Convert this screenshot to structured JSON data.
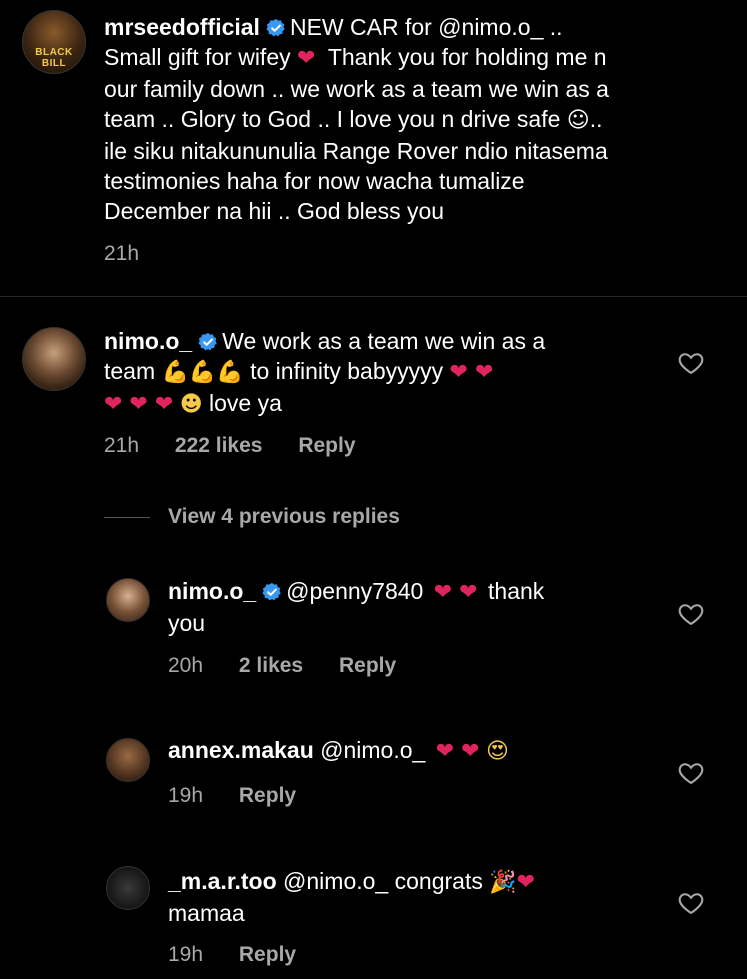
{
  "caption": {
    "username": "mrseedofficial",
    "avatar_text": "BLACK BILL",
    "lines": [
      "NEW CAR for @nimo.o_ ..",
      "Small gift for wifey",
      "Thank you for holding me n",
      "our family down .. we work as a team we win as a",
      "team .. Glory to God .. I love you n drive safe",
      "..",
      "ile siku nitakununulia Range Rover ndio nitasema",
      "testimonies haha for now wacha tumalize",
      "December na hii .. God bless you"
    ],
    "time": "21h"
  },
  "comment": {
    "username": "nimo.o_",
    "line1": "We work as a team we win as a",
    "line2a": "team",
    "line2b": "to infinity babyyyyy",
    "line3": "love ya",
    "time": "21h",
    "likes": "222 likes",
    "reply": "Reply"
  },
  "view_replies": "View 4 previous replies",
  "replies": [
    {
      "username": "nimo.o_",
      "mention": "@penny7840",
      "after": "thank",
      "line2": "you",
      "time": "20h",
      "likes": "2 likes",
      "reply": "Reply"
    },
    {
      "username": "annex.makau",
      "mention": "@nimo.o_",
      "time": "19h",
      "reply": "Reply"
    },
    {
      "username": "_m.a.r.too",
      "mention": "@nimo.o_",
      "text": "congrats",
      "line2": "mamaa",
      "time": "19h",
      "reply": "Reply"
    }
  ],
  "icons": {
    "verified": "verified-badge-icon",
    "like": "heart-outline-icon"
  },
  "colors": {
    "background": "#000000",
    "muted": "#a8a8a8",
    "verified": "#3897f0",
    "heart": "#e0245e"
  }
}
